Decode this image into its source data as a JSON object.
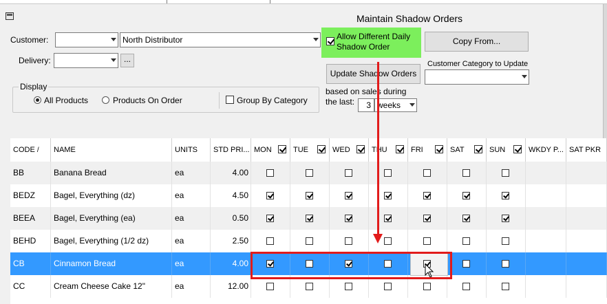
{
  "window": {
    "title": "Maintain Shadow Orders"
  },
  "customer": {
    "label": "Customer:",
    "code_value": "",
    "name_value": "North Distributor"
  },
  "delivery": {
    "label": "Delivery:",
    "value": "",
    "browse_label": "..."
  },
  "display": {
    "title": "Display",
    "all_products_label": "All Products",
    "products_on_order_label": "Products On Order",
    "group_by_category_label": "Group By Category",
    "all_products_selected": true,
    "group_by_category_checked": false
  },
  "allow_daily": {
    "label_line1": "Allow Different Daily",
    "label_line2": "Shadow Order",
    "checked": true,
    "highlight_color": "#7cef5c"
  },
  "copy_from": {
    "label": "Copy From..."
  },
  "update_button": {
    "label": "Update Shadow Orders"
  },
  "category_update": {
    "label": "Customer Category to Update",
    "value": ""
  },
  "based_on": {
    "label_line1": "based on sales during",
    "label_line2": "the last:",
    "count": "3",
    "unit": "weeks"
  },
  "grid": {
    "columns": [
      "CODE",
      "NAME",
      "UNITS",
      "STD PRI...",
      "MON",
      "TUE",
      "WED",
      "THU",
      "FRI",
      "SAT",
      "SUN",
      "WKDY P...",
      "SAT PKR"
    ],
    "sort_indicator": "/",
    "day_header_checked": [
      true,
      true,
      true,
      true,
      true,
      true,
      true
    ],
    "rows": [
      {
        "code": "BB",
        "name": "Banana Bread",
        "units": "ea",
        "price": "4.00",
        "days": [
          false,
          false,
          false,
          false,
          false,
          false,
          false
        ]
      },
      {
        "code": "BEDZ",
        "name": "Bagel, Everything (dz)",
        "units": "ea",
        "price": "4.50",
        "days": [
          true,
          true,
          true,
          true,
          true,
          true,
          true
        ]
      },
      {
        "code": "BEEA",
        "name": "Bagel, Everything (ea)",
        "units": "ea",
        "price": "0.50",
        "days": [
          true,
          true,
          true,
          true,
          true,
          true,
          true
        ]
      },
      {
        "code": "BEHD",
        "name": "Bagel, Everything (1/2 dz)",
        "units": "ea",
        "price": "2.50",
        "days": [
          false,
          false,
          false,
          false,
          false,
          false,
          false
        ]
      },
      {
        "code": "CB",
        "name": "Cinnamon Bread",
        "units": "ea",
        "price": "4.00",
        "days": [
          true,
          false,
          true,
          false,
          true,
          false,
          false
        ]
      },
      {
        "code": "CC",
        "name": "Cream Cheese Cake 12\"",
        "units": "ea",
        "price": "12.00",
        "days": [
          false,
          false,
          false,
          false,
          false,
          false,
          false
        ]
      }
    ]
  },
  "colors": {
    "selection": "#3399ff",
    "annotation_red": "#e21b1b",
    "highlight_green": "#7cef5c"
  }
}
